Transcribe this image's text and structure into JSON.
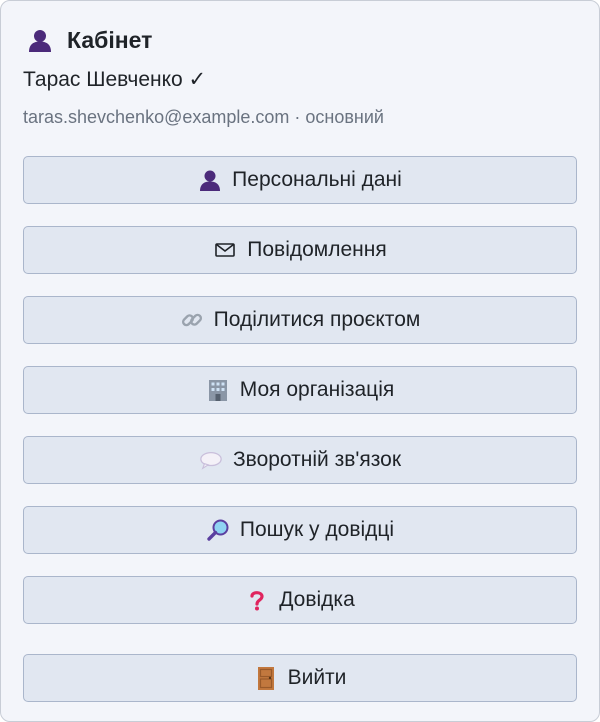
{
  "header": {
    "title": "Кабінет",
    "icon": "user-silhouette-icon"
  },
  "user": {
    "name": "Тарас Шевченко ✓",
    "email_line": "taras.shevchenko@example.com · основний"
  },
  "menu": [
    {
      "label": "Персональні дані",
      "icon": "user-silhouette-icon"
    },
    {
      "label": "Повідомлення",
      "icon": "envelope-icon"
    },
    {
      "label": "Поділитися проєктом",
      "icon": "link-icon"
    },
    {
      "label": "Моя організація",
      "icon": "office-building-icon"
    },
    {
      "label": "Зворотній зв'язок",
      "icon": "speech-bubble-icon"
    },
    {
      "label": "Пошук у довідці",
      "icon": "magnifier-icon"
    },
    {
      "label": "Довідка",
      "icon": "question-mark-icon"
    },
    {
      "label": "Вийти",
      "icon": "door-icon"
    }
  ],
  "colors": {
    "panel_bg": "#f3f5fa",
    "button_bg": "#e1e7f1",
    "button_border": "#aab6cb",
    "muted_text": "#6a7380",
    "user_icon": "#4b2a7a",
    "question_icon": "#e0245e",
    "door_icon": "#c2783e"
  }
}
